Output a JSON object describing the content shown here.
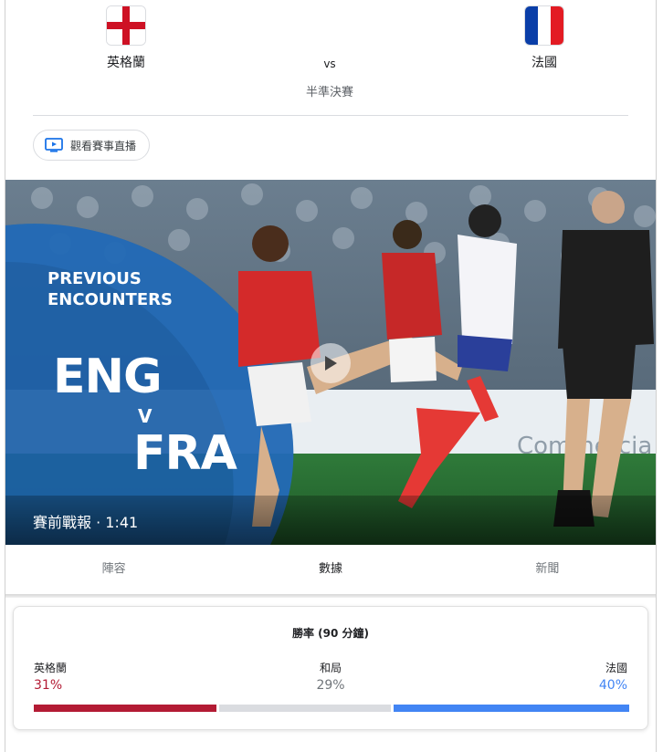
{
  "match": {
    "home": {
      "name": "英格蘭",
      "flag": "england-flag-icon"
    },
    "away": {
      "name": "法國",
      "flag": "france-flag-icon"
    },
    "vs": "vs",
    "stage": "半準決賽",
    "watch_label": "觀看賽事直播"
  },
  "video": {
    "overlay_line1": "PREVIOUS",
    "overlay_line2": "ENCOUNTERS",
    "overlay_eng": "ENG",
    "overlay_v": "V",
    "overlay_fra": "FRA",
    "caption": "賽前戰報 · 1:41"
  },
  "tabs": [
    {
      "label": "陣容",
      "active": false
    },
    {
      "label": "數據",
      "active": true
    },
    {
      "label": "新聞",
      "active": false
    }
  ],
  "win_probability": {
    "title": "勝率 (90 分鐘)",
    "home": {
      "label": "英格蘭",
      "pct": "31%",
      "value": 31,
      "color": "#b31b34"
    },
    "draw": {
      "label": "和局",
      "pct": "29%",
      "value": 29,
      "color": "#dadce0"
    },
    "away": {
      "label": "法國",
      "pct": "40%",
      "value": 40,
      "color": "#4285f4"
    }
  }
}
